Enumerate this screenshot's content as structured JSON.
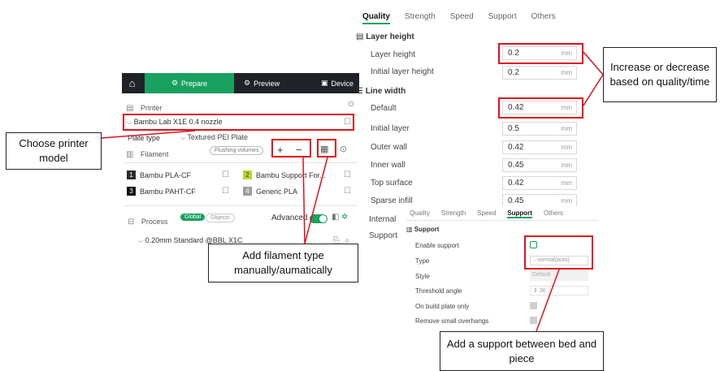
{
  "left": {
    "nav": {
      "prepare": "Prepare",
      "preview": "Preview",
      "device": "Device"
    },
    "printer": {
      "section_title": "Printer",
      "selected_printer": "Bambu Lab X1E 0.4 nozzle",
      "plate_type_label": "Plate type",
      "plate_type_value": "Textured PEI Plate"
    },
    "filament": {
      "section_title": "Filament",
      "flushing_button": "Flushing volumes",
      "add_symbol": "+",
      "remove_symbol": "−",
      "items": [
        {
          "index": "1",
          "name": "Bambu PLA-CF",
          "color": "#2b2b2b"
        },
        {
          "index": "2",
          "name": "Bambu Support For...",
          "color": "#b7d62d"
        },
        {
          "index": "3",
          "name": "Bambu PAHT-CF",
          "color": "#111111"
        },
        {
          "index": "4",
          "name": "Generic PLA",
          "color": "#9e9e9e"
        }
      ]
    },
    "process": {
      "section_title": "Process",
      "global": "Global",
      "objects": "Objects",
      "advanced": "Advanced",
      "preset": "0.20mm Standard @BBL X1C"
    }
  },
  "quality": {
    "tabs": [
      "Quality",
      "Strength",
      "Speed",
      "Support",
      "Others"
    ],
    "layer_height_section": "Layer height",
    "rows_layer": [
      {
        "label": "Layer height",
        "value": "0.2",
        "unit": "mm"
      },
      {
        "label": "Initial layer height",
        "value": "0.2",
        "unit": "mm"
      }
    ],
    "line_width_section": "Line width",
    "rows_line": [
      {
        "label": "Default",
        "value": "0.42",
        "unit": "mm"
      },
      {
        "label": "Initial layer",
        "value": "0.5",
        "unit": "mm"
      },
      {
        "label": "Outer wall",
        "value": "0.42",
        "unit": "mm"
      },
      {
        "label": "Inner wall",
        "value": "0.45",
        "unit": "mm"
      },
      {
        "label": "Top surface",
        "value": "0.42",
        "unit": "mm"
      },
      {
        "label": "Sparse infill",
        "value": "0.45",
        "unit": "mm"
      }
    ],
    "partial_labels": [
      "Internal",
      "Support"
    ]
  },
  "support": {
    "tabs": [
      "Quality",
      "Strength",
      "Speed",
      "Support",
      "Others"
    ],
    "section_title": "Support",
    "rows": [
      {
        "label": "Enable support"
      },
      {
        "label": "Type",
        "value": "normal(auto)"
      },
      {
        "label": "Style",
        "value": "Default"
      },
      {
        "label": "Threshold angle",
        "value": "30"
      },
      {
        "label": "On build plate only"
      },
      {
        "label": "Remove small overhangs"
      }
    ]
  },
  "callouts": {
    "choose_printer": "Choose printer model",
    "add_filament": "Add filament type manually/aumatically",
    "quality_time": "Increase or decrease based on quality/time",
    "support_between": "Add a support between bed and piece"
  },
  "colors": {
    "accent": "#19a15f",
    "highlight": "#e0121d",
    "toolbar": "#1f2328"
  }
}
